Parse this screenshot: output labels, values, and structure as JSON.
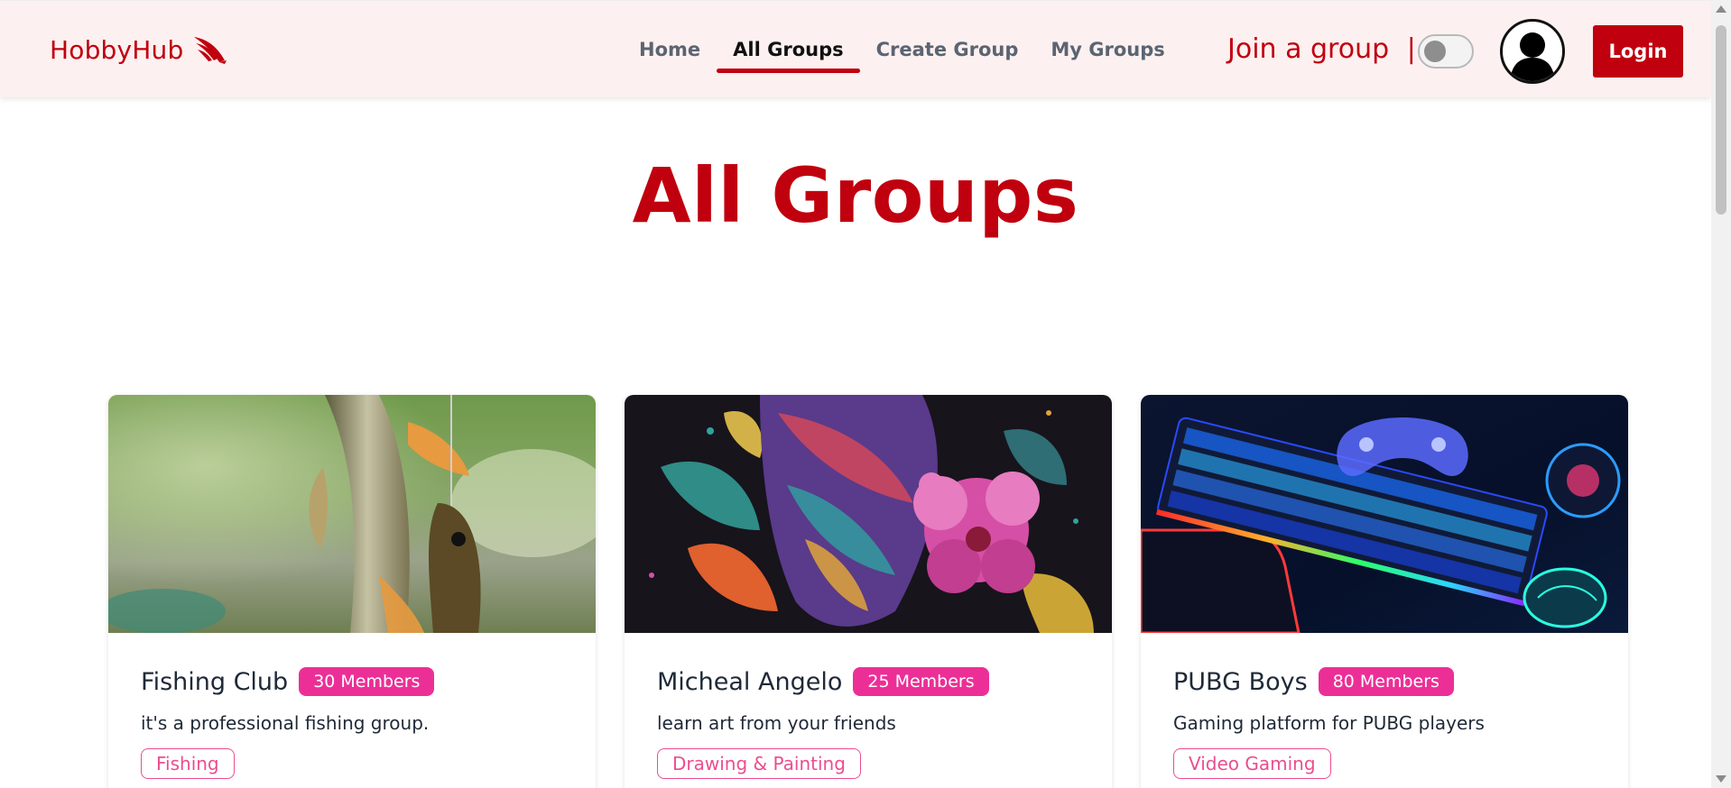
{
  "brand": {
    "name": "HobbyHub",
    "icon": "wing-icon"
  },
  "nav": {
    "links": [
      {
        "label": "Home",
        "active": false
      },
      {
        "label": "All Groups",
        "active": true
      },
      {
        "label": "Create Group",
        "active": false
      },
      {
        "label": "My Groups",
        "active": false
      }
    ]
  },
  "header_right": {
    "join_text": "Join a group",
    "separator": "|",
    "toggle_state": "off",
    "avatar_icon": "user-silhouette-icon",
    "login_label": "Login"
  },
  "page": {
    "title": "All Groups"
  },
  "groups": [
    {
      "name": "Fishing Club",
      "members": "30 Members",
      "description": "it's a professional fishing group.",
      "category": "Fishing",
      "image": "fish-photo"
    },
    {
      "name": "Micheal Angelo",
      "members": "25 Members",
      "description": "learn art from your friends",
      "category": "Drawing & Painting",
      "image": "colorful-bird-flower-art"
    },
    {
      "name": "PUBG Boys",
      "members": "80 Members",
      "description": "Gaming platform for PUBG players",
      "category": "Video Gaming",
      "image": "rgb-gaming-setup"
    }
  ],
  "colors": {
    "primary": "#c0000e",
    "badge": "#ec2f97",
    "tag": "#ec4d8f",
    "navbar_bg": "#fdf0f0"
  }
}
